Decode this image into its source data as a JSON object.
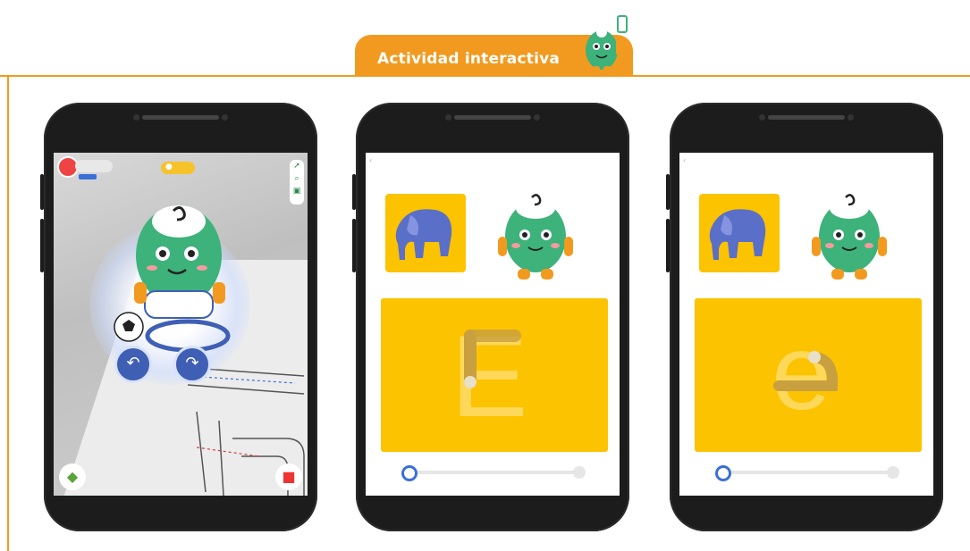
{
  "header": {
    "title": "Actividad interactiva",
    "accent_color": "#f29a1f",
    "mascot_icon": "mascot-with-phone-icon"
  },
  "phone_ar": {
    "hud": {
      "user_avatar_icon": "user-avatar-icon",
      "coin_icon": "coin-icon",
      "side_icons": [
        "map-pin-icon",
        "search-icon",
        "photo-icon"
      ]
    },
    "character": "mascot-soccer-player",
    "buttons": [
      {
        "icon": "rotate-left-icon",
        "label": "↶"
      },
      {
        "icon": "rotate-right-icon",
        "label": "↷"
      }
    ],
    "bottom_left_icon": "cube-icon",
    "bottom_right_icon": "camera-icon"
  },
  "phone_letter_E": {
    "thumbnail": "elephant-icon",
    "mascot": "mascot-icon",
    "letter": "E",
    "progress": 0
  },
  "phone_letter_e": {
    "thumbnail": "elephant-icon",
    "mascot": "mascot-icon",
    "letter": "e",
    "progress": 0
  },
  "colors": {
    "yellow": "#fcc300",
    "mascot_green": "#3db27a",
    "progress_blue": "#3a6fd8"
  }
}
